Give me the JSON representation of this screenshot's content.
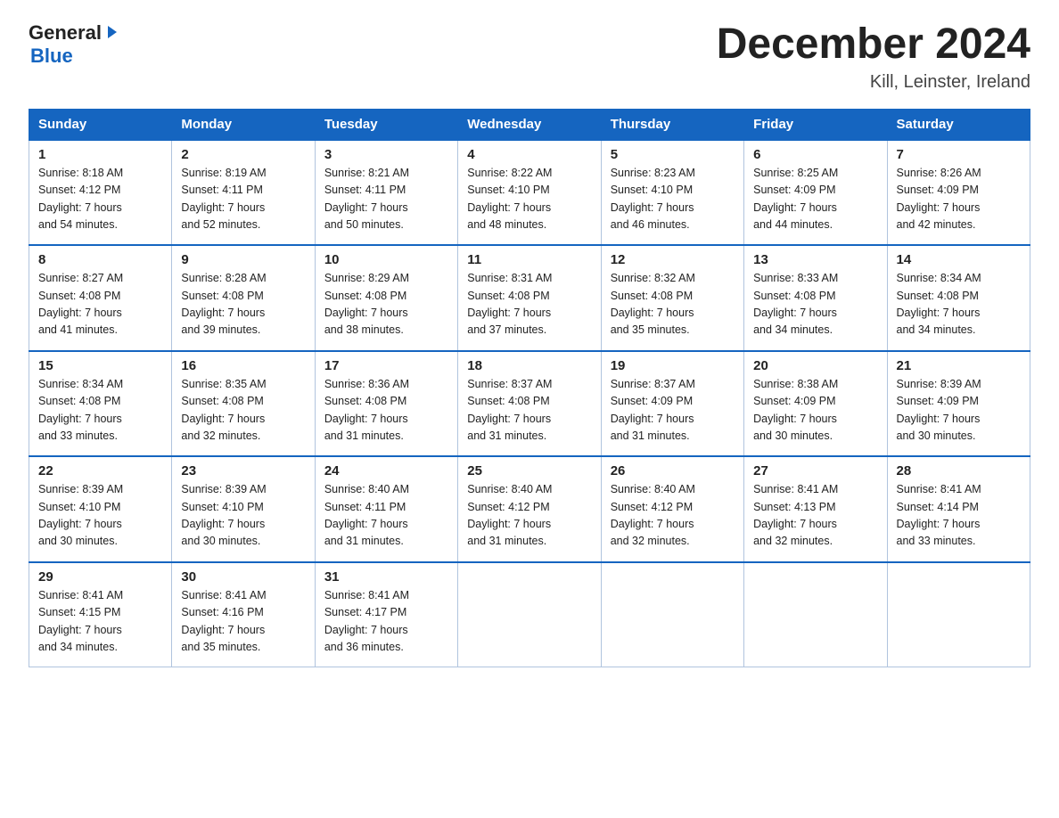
{
  "logo": {
    "general": "General",
    "blue": "Blue",
    "arrow": "▶"
  },
  "title": "December 2024",
  "location": "Kill, Leinster, Ireland",
  "days_of_week": [
    "Sunday",
    "Monday",
    "Tuesday",
    "Wednesday",
    "Thursday",
    "Friday",
    "Saturday"
  ],
  "weeks": [
    [
      {
        "day": "1",
        "sunrise": "8:18 AM",
        "sunset": "4:12 PM",
        "daylight": "7 hours and 54 minutes."
      },
      {
        "day": "2",
        "sunrise": "8:19 AM",
        "sunset": "4:11 PM",
        "daylight": "7 hours and 52 minutes."
      },
      {
        "day": "3",
        "sunrise": "8:21 AM",
        "sunset": "4:11 PM",
        "daylight": "7 hours and 50 minutes."
      },
      {
        "day": "4",
        "sunrise": "8:22 AM",
        "sunset": "4:10 PM",
        "daylight": "7 hours and 48 minutes."
      },
      {
        "day": "5",
        "sunrise": "8:23 AM",
        "sunset": "4:10 PM",
        "daylight": "7 hours and 46 minutes."
      },
      {
        "day": "6",
        "sunrise": "8:25 AM",
        "sunset": "4:09 PM",
        "daylight": "7 hours and 44 minutes."
      },
      {
        "day": "7",
        "sunrise": "8:26 AM",
        "sunset": "4:09 PM",
        "daylight": "7 hours and 42 minutes."
      }
    ],
    [
      {
        "day": "8",
        "sunrise": "8:27 AM",
        "sunset": "4:08 PM",
        "daylight": "7 hours and 41 minutes."
      },
      {
        "day": "9",
        "sunrise": "8:28 AM",
        "sunset": "4:08 PM",
        "daylight": "7 hours and 39 minutes."
      },
      {
        "day": "10",
        "sunrise": "8:29 AM",
        "sunset": "4:08 PM",
        "daylight": "7 hours and 38 minutes."
      },
      {
        "day": "11",
        "sunrise": "8:31 AM",
        "sunset": "4:08 PM",
        "daylight": "7 hours and 37 minutes."
      },
      {
        "day": "12",
        "sunrise": "8:32 AM",
        "sunset": "4:08 PM",
        "daylight": "7 hours and 35 minutes."
      },
      {
        "day": "13",
        "sunrise": "8:33 AM",
        "sunset": "4:08 PM",
        "daylight": "7 hours and 34 minutes."
      },
      {
        "day": "14",
        "sunrise": "8:34 AM",
        "sunset": "4:08 PM",
        "daylight": "7 hours and 34 minutes."
      }
    ],
    [
      {
        "day": "15",
        "sunrise": "8:34 AM",
        "sunset": "4:08 PM",
        "daylight": "7 hours and 33 minutes."
      },
      {
        "day": "16",
        "sunrise": "8:35 AM",
        "sunset": "4:08 PM",
        "daylight": "7 hours and 32 minutes."
      },
      {
        "day": "17",
        "sunrise": "8:36 AM",
        "sunset": "4:08 PM",
        "daylight": "7 hours and 31 minutes."
      },
      {
        "day": "18",
        "sunrise": "8:37 AM",
        "sunset": "4:08 PM",
        "daylight": "7 hours and 31 minutes."
      },
      {
        "day": "19",
        "sunrise": "8:37 AM",
        "sunset": "4:09 PM",
        "daylight": "7 hours and 31 minutes."
      },
      {
        "day": "20",
        "sunrise": "8:38 AM",
        "sunset": "4:09 PM",
        "daylight": "7 hours and 30 minutes."
      },
      {
        "day": "21",
        "sunrise": "8:39 AM",
        "sunset": "4:09 PM",
        "daylight": "7 hours and 30 minutes."
      }
    ],
    [
      {
        "day": "22",
        "sunrise": "8:39 AM",
        "sunset": "4:10 PM",
        "daylight": "7 hours and 30 minutes."
      },
      {
        "day": "23",
        "sunrise": "8:39 AM",
        "sunset": "4:10 PM",
        "daylight": "7 hours and 30 minutes."
      },
      {
        "day": "24",
        "sunrise": "8:40 AM",
        "sunset": "4:11 PM",
        "daylight": "7 hours and 31 minutes."
      },
      {
        "day": "25",
        "sunrise": "8:40 AM",
        "sunset": "4:12 PM",
        "daylight": "7 hours and 31 minutes."
      },
      {
        "day": "26",
        "sunrise": "8:40 AM",
        "sunset": "4:12 PM",
        "daylight": "7 hours and 32 minutes."
      },
      {
        "day": "27",
        "sunrise": "8:41 AM",
        "sunset": "4:13 PM",
        "daylight": "7 hours and 32 minutes."
      },
      {
        "day": "28",
        "sunrise": "8:41 AM",
        "sunset": "4:14 PM",
        "daylight": "7 hours and 33 minutes."
      }
    ],
    [
      {
        "day": "29",
        "sunrise": "8:41 AM",
        "sunset": "4:15 PM",
        "daylight": "7 hours and 34 minutes."
      },
      {
        "day": "30",
        "sunrise": "8:41 AM",
        "sunset": "4:16 PM",
        "daylight": "7 hours and 35 minutes."
      },
      {
        "day": "31",
        "sunrise": "8:41 AM",
        "sunset": "4:17 PM",
        "daylight": "7 hours and 36 minutes."
      },
      null,
      null,
      null,
      null
    ]
  ],
  "labels": {
    "sunrise": "Sunrise:",
    "sunset": "Sunset:",
    "daylight": "Daylight:"
  }
}
